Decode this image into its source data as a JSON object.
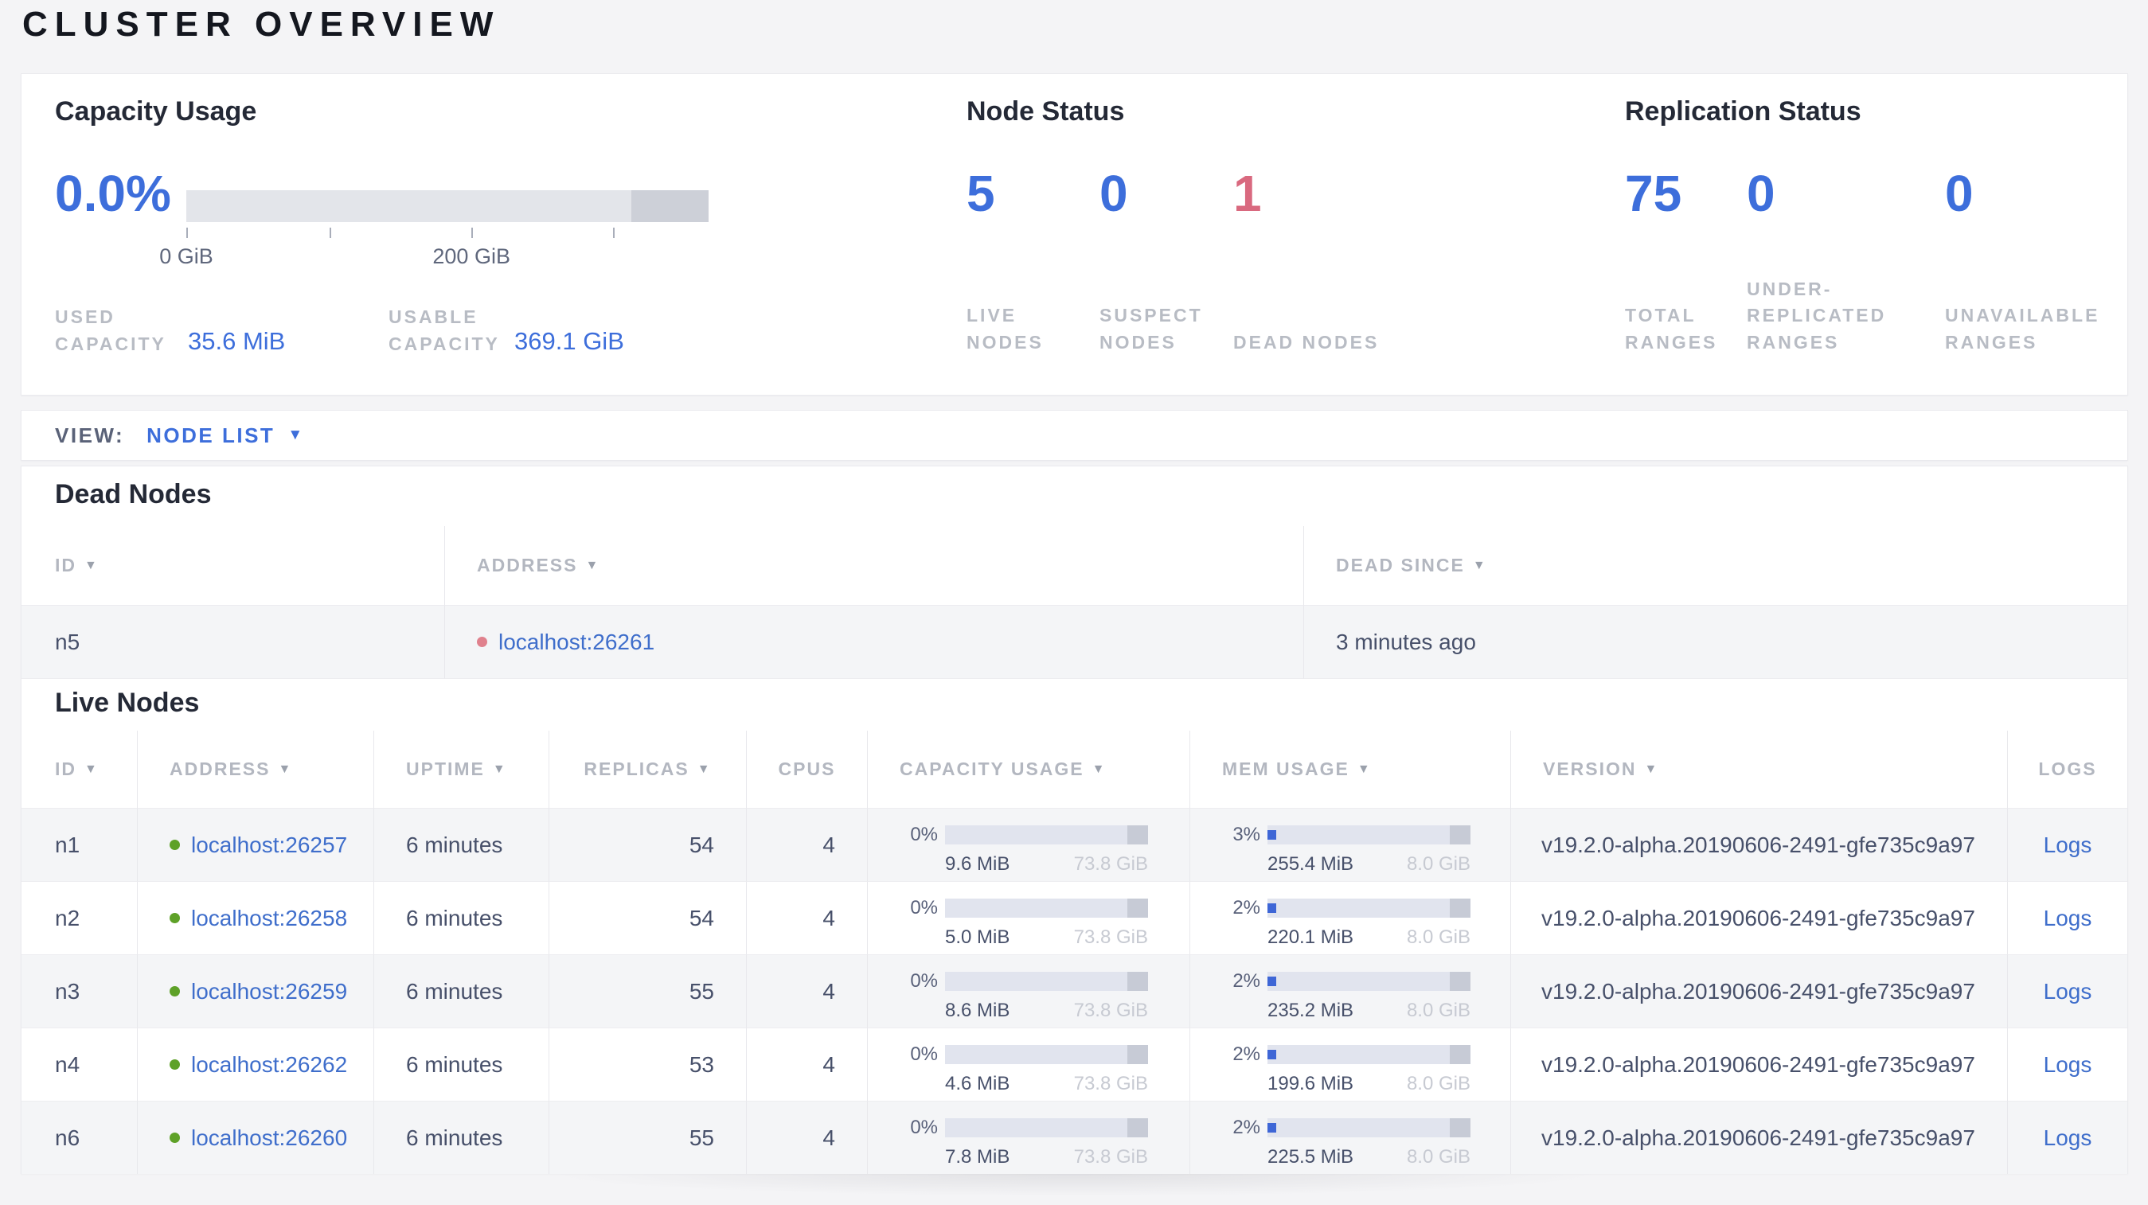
{
  "title": "CLUSTER OVERVIEW",
  "colors": {
    "accent_blue": "#3d6edb",
    "link_blue": "#3f6ecb",
    "danger_red": "#d9697f",
    "live_dot": "#5ea128",
    "dead_dot": "#e0818d",
    "fill_blue": "#3e66d6"
  },
  "summary": {
    "capacity": {
      "heading": "Capacity Usage",
      "percent": "0.0%",
      "bar": {
        "dark_start_pct": 85.2,
        "ticks": [
          {
            "pos_pct": 0,
            "label": "0 GiB"
          },
          {
            "pos_pct": 27.4,
            "label": ""
          },
          {
            "pos_pct": 54.6,
            "label": "200 GiB"
          },
          {
            "pos_pct": 81.7,
            "label": ""
          }
        ]
      },
      "stats": [
        {
          "label": "USED CAPACITY",
          "value": "35.6 MiB"
        },
        {
          "label": "USABLE CAPACITY",
          "value": "369.1 GiB"
        }
      ]
    },
    "nodes": {
      "heading": "Node Status",
      "stats": [
        {
          "value": "5",
          "label": "LIVE NODES"
        },
        {
          "value": "0",
          "label": "SUSPECT NODES"
        },
        {
          "value": "1",
          "label": "DEAD NODES"
        }
      ]
    },
    "replication": {
      "heading": "Replication Status",
      "stats": [
        {
          "value": "75",
          "label": "TOTAL RANGES"
        },
        {
          "value": "0",
          "label": "UNDER-REPLICATED RANGES"
        },
        {
          "value": "0",
          "label": "UNAVAILABLE RANGES"
        }
      ]
    }
  },
  "view_bar": {
    "label": "VIEW:",
    "selected": "NODE LIST",
    "caret": "▼"
  },
  "dead_nodes": {
    "heading": "Dead Nodes",
    "columns": [
      {
        "label": "ID",
        "arrow": "▼"
      },
      {
        "label": "ADDRESS",
        "arrow": "▼"
      },
      {
        "label": "DEAD SINCE",
        "arrow": "▼"
      }
    ],
    "rows": [
      {
        "id": "n5",
        "address": "localhost:26261",
        "dead_since": "3 minutes ago"
      }
    ]
  },
  "live_nodes": {
    "heading": "Live Nodes",
    "columns": [
      {
        "label": "ID",
        "arrow": "▼"
      },
      {
        "label": "ADDRESS",
        "arrow": "▼"
      },
      {
        "label": "UPTIME",
        "arrow": "▼"
      },
      {
        "label": "REPLICAS",
        "arrow": "▼"
      },
      {
        "label": "CPUS",
        "arrow": ""
      },
      {
        "label": "CAPACITY USAGE",
        "arrow": "▼"
      },
      {
        "label": "MEM USAGE",
        "arrow": "▼"
      },
      {
        "label": "VERSION",
        "arrow": "▼"
      },
      {
        "label": "LOGS",
        "arrow": ""
      }
    ],
    "rows": [
      {
        "id": "n1",
        "address": "localhost:26257",
        "uptime": "6 minutes",
        "replicas": "54",
        "cpus": "4",
        "cap_pct": "0%",
        "cap_pct_num": 0,
        "cap_used": "9.6 MiB",
        "cap_total": "73.8 GiB",
        "mem_pct": "3%",
        "mem_pct_num": 3,
        "mem_used": "255.4 MiB",
        "mem_total": "8.0 GiB",
        "version": "v19.2.0-alpha.20190606-2491-gfe735c9a97",
        "logs": "Logs"
      },
      {
        "id": "n2",
        "address": "localhost:26258",
        "uptime": "6 minutes",
        "replicas": "54",
        "cpus": "4",
        "cap_pct": "0%",
        "cap_pct_num": 0,
        "cap_used": "5.0 MiB",
        "cap_total": "73.8 GiB",
        "mem_pct": "2%",
        "mem_pct_num": 2,
        "mem_used": "220.1 MiB",
        "mem_total": "8.0 GiB",
        "version": "v19.2.0-alpha.20190606-2491-gfe735c9a97",
        "logs": "Logs"
      },
      {
        "id": "n3",
        "address": "localhost:26259",
        "uptime": "6 minutes",
        "replicas": "55",
        "cpus": "4",
        "cap_pct": "0%",
        "cap_pct_num": 0,
        "cap_used": "8.6 MiB",
        "cap_total": "73.8 GiB",
        "mem_pct": "2%",
        "mem_pct_num": 2,
        "mem_used": "235.2 MiB",
        "mem_total": "8.0 GiB",
        "version": "v19.2.0-alpha.20190606-2491-gfe735c9a97",
        "logs": "Logs"
      },
      {
        "id": "n4",
        "address": "localhost:26262",
        "uptime": "6 minutes",
        "replicas": "53",
        "cpus": "4",
        "cap_pct": "0%",
        "cap_pct_num": 0,
        "cap_used": "4.6 MiB",
        "cap_total": "73.8 GiB",
        "mem_pct": "2%",
        "mem_pct_num": 2,
        "mem_used": "199.6 MiB",
        "mem_total": "8.0 GiB",
        "version": "v19.2.0-alpha.20190606-2491-gfe735c9a97",
        "logs": "Logs"
      },
      {
        "id": "n6",
        "address": "localhost:26260",
        "uptime": "6 minutes",
        "replicas": "55",
        "cpus": "4",
        "cap_pct": "0%",
        "cap_pct_num": 0,
        "cap_used": "7.8 MiB",
        "cap_total": "73.8 GiB",
        "mem_pct": "2%",
        "mem_pct_num": 2,
        "mem_used": "225.5 MiB",
        "mem_total": "8.0 GiB",
        "version": "v19.2.0-alpha.20190606-2491-gfe735c9a97",
        "logs": "Logs"
      }
    ]
  }
}
